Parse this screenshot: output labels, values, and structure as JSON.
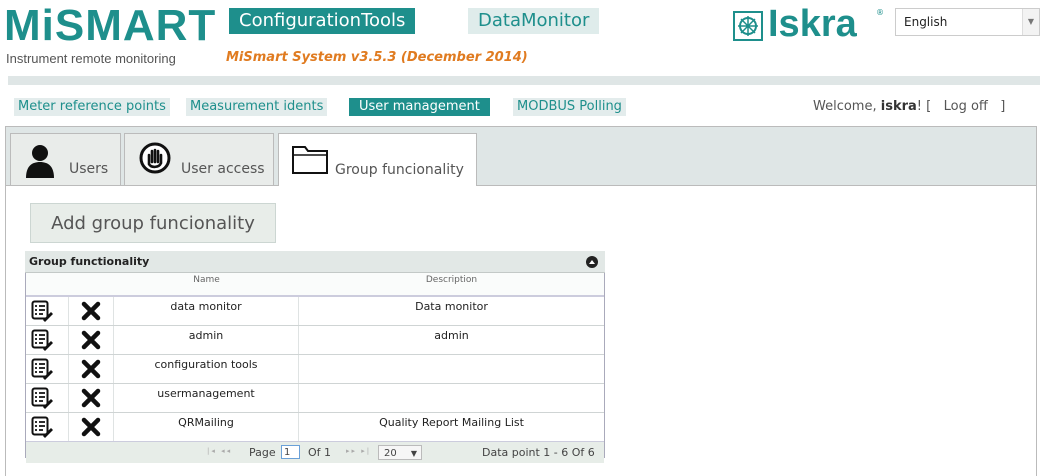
{
  "header": {
    "logo": "MiSMART",
    "subtitle": "Instrument remote monitoring",
    "version": "MiSmart System v3.5.3 (December 2014)",
    "app_tabs": [
      "ConfigurationTools",
      "DataMonitor"
    ],
    "brand": "Iskra",
    "brand_mark": "®",
    "language": "English",
    "accent_color": "#1e8f8c",
    "version_color": "#e07b20"
  },
  "nav": {
    "items": [
      "Meter reference points",
      "Measurement idents",
      "User management",
      "MODBUS Polling"
    ],
    "active": "User management",
    "welcome_prefix": "Welcome,",
    "username": "iskra",
    "welcome_suffix": "! [",
    "logoff": "Log off",
    "logoff_suffix": "]"
  },
  "tabs": [
    {
      "label": "Users",
      "icon": "user-icon"
    },
    {
      "label": "User access",
      "icon": "hand-stop-icon"
    },
    {
      "label": "Group funcionality",
      "icon": "folder-icon",
      "selected": true
    }
  ],
  "add_button": "Add group funcionality",
  "grid": {
    "title": "Group functionality",
    "columns": {
      "name": "Name",
      "description": "Description"
    },
    "rows": [
      {
        "name": "data monitor",
        "description": "Data monitor"
      },
      {
        "name": "admin",
        "description": "admin"
      },
      {
        "name": "configuration tools",
        "description": ""
      },
      {
        "name": "usermanagement",
        "description": ""
      },
      {
        "name": "QRMailing",
        "description": "Quality Report Mailing List"
      }
    ],
    "row_icons": {
      "edit": "edit-list-icon",
      "delete": "delete-x-icon"
    },
    "pager": {
      "page_label": "Page",
      "page": "1",
      "of_label": "Of 1",
      "page_size": "20",
      "info": "Data point 1 - 6 Of 6",
      "first_prev": "|◂ ◂◂",
      "next_last": "▸▸ ▸|"
    }
  }
}
